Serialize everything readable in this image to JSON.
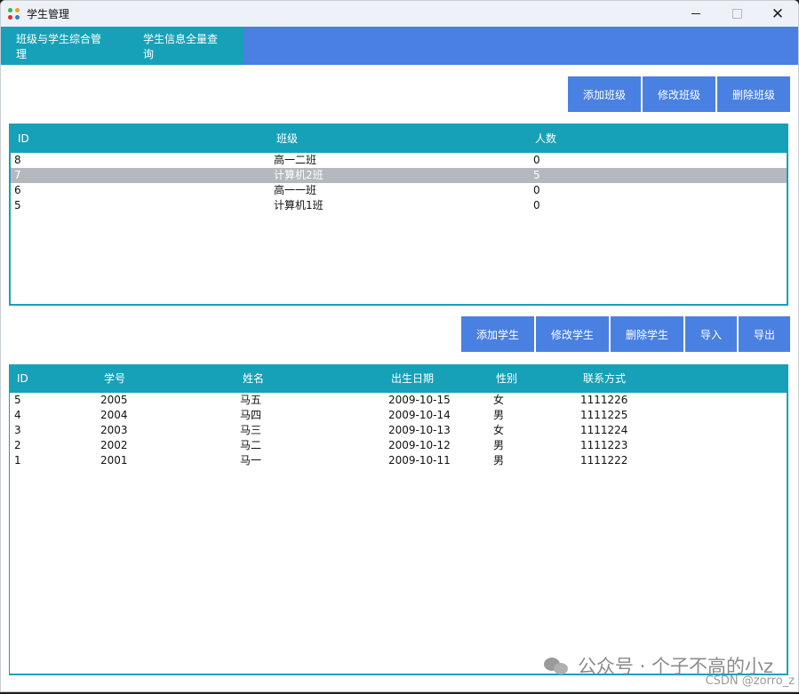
{
  "window": {
    "title": "学生管理"
  },
  "nav": {
    "tabs": [
      {
        "label": "班级与学生综合管理"
      },
      {
        "label": "学生信息全量查询"
      }
    ]
  },
  "class_actions": {
    "add": "添加班级",
    "edit": "修改班级",
    "delete": "删除班级"
  },
  "class_table": {
    "headers": [
      "ID",
      "班级",
      "人数"
    ],
    "rows": [
      [
        "8",
        "高一二班",
        "0"
      ],
      [
        "7",
        "计算机2班",
        "5"
      ],
      [
        "6",
        "高一一班",
        "0"
      ],
      [
        "5",
        "计算机1班",
        "0"
      ]
    ],
    "selected_index": 1
  },
  "student_actions": {
    "add": "添加学生",
    "edit": "修改学生",
    "delete": "删除学生",
    "import": "导入",
    "export": "导出"
  },
  "student_table": {
    "headers": [
      "ID",
      "学号",
      "姓名",
      "出生日期",
      "性别",
      "联系方式"
    ],
    "rows": [
      [
        "5",
        "2005",
        "马五",
        "2009-10-15",
        "女",
        "1111226"
      ],
      [
        "4",
        "2004",
        "马四",
        "2009-10-14",
        "男",
        "1111225"
      ],
      [
        "3",
        "2003",
        "马三",
        "2009-10-13",
        "女",
        "1111224"
      ],
      [
        "2",
        "2002",
        "马二",
        "2009-10-12",
        "男",
        "1111223"
      ],
      [
        "1",
        "2001",
        "马一",
        "2009-10-11",
        "男",
        "1111222"
      ]
    ]
  },
  "watermark": {
    "text": "公众号 · 个子不高的小z",
    "credit": "CSDN @zorro_z"
  },
  "colors": {
    "accent": "#4a80e2",
    "teal": "#17a1b8",
    "selected_row": "#b5b9bf"
  }
}
